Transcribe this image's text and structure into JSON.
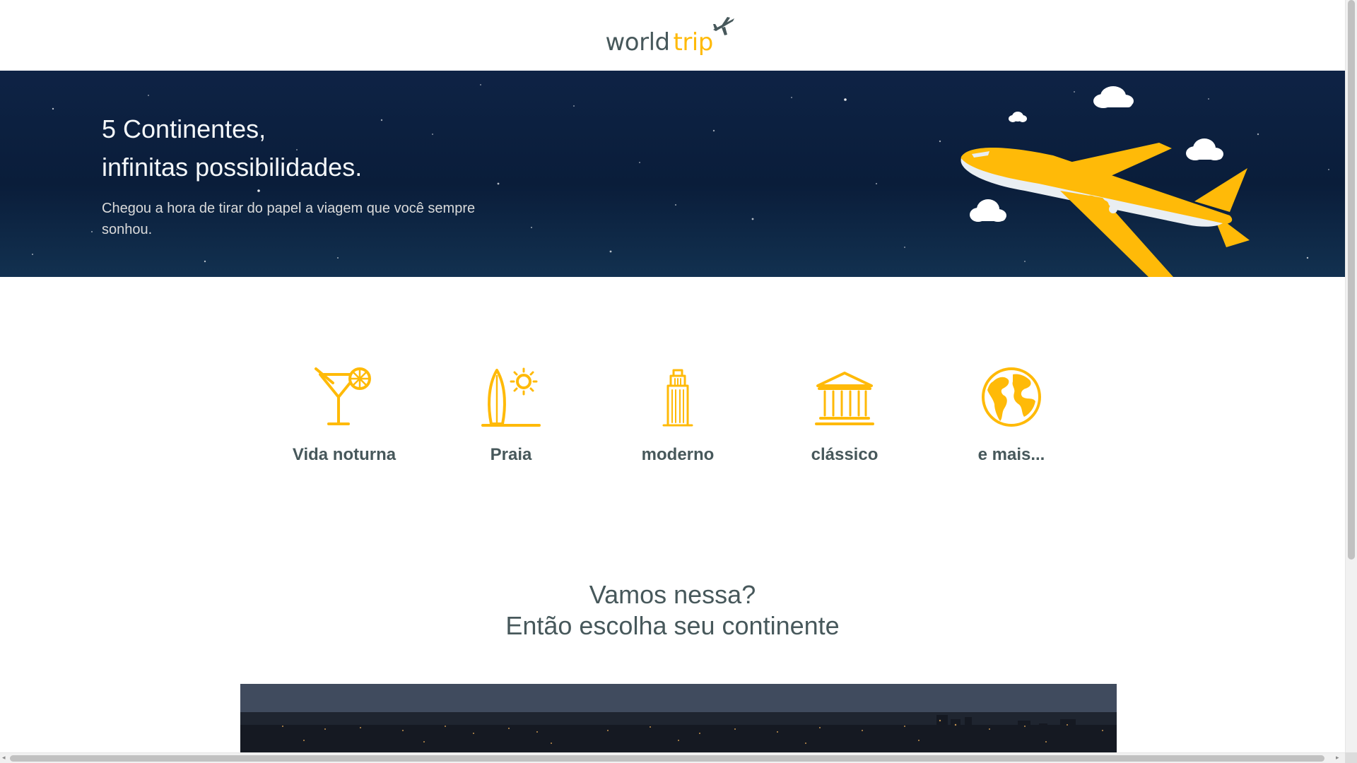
{
  "header": {
    "logo_world": "world",
    "logo_trip": "trip"
  },
  "banner": {
    "title_line1": "5 Continentes,",
    "title_line2": "infinitas possibilidades.",
    "text": "Chegou a hora de tirar do papel a viagem que você sempre sonhou."
  },
  "types": [
    {
      "label": "Vida noturna",
      "icon": "cocktail-icon"
    },
    {
      "label": "Praia",
      "icon": "surf-sun-icon"
    },
    {
      "label": "moderno",
      "icon": "building-icon"
    },
    {
      "label": "clássico",
      "icon": "museum-icon"
    },
    {
      "label": "e mais...",
      "icon": "earth-icon"
    }
  ],
  "cta": {
    "line1": "Vamos nessa?",
    "line2": "Então escolha seu continente"
  },
  "colors": {
    "accent": "#FFBA08",
    "heading": "#47585B",
    "banner_bg": "#0e2345",
    "banner_text": "#F5F8FA"
  }
}
